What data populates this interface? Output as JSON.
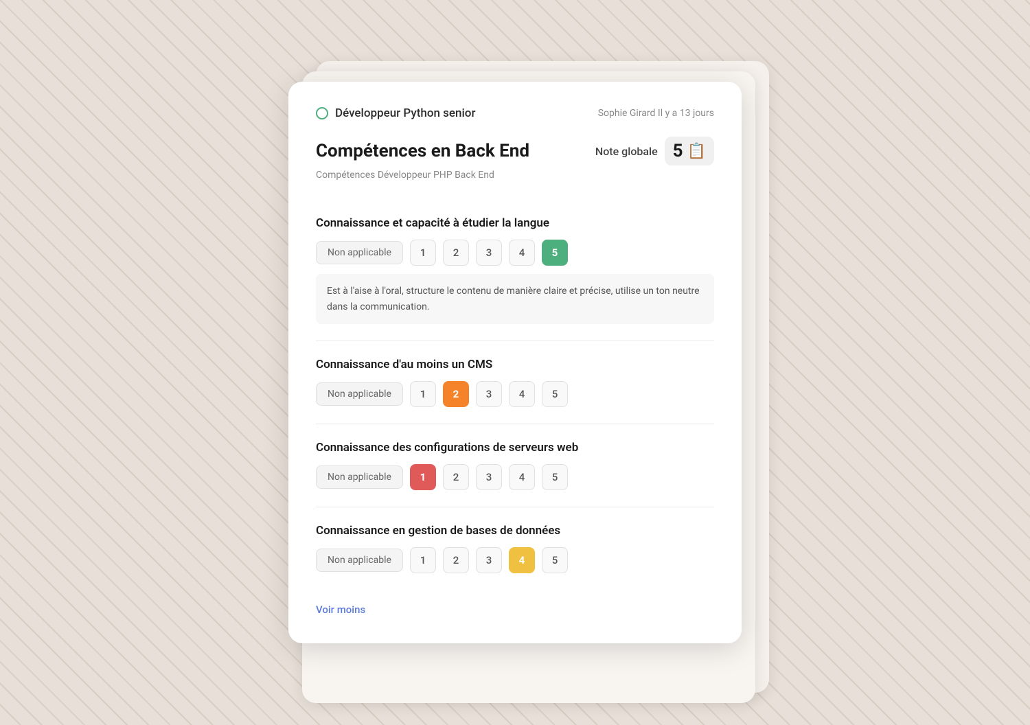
{
  "background": {
    "color": "#e8e0d8"
  },
  "card": {
    "job_title": "Développeur Python senior",
    "meta": "Sophie Girard Il y a 13 jours",
    "status_dot_color": "#4caf7d",
    "main_title": "Compétences en Back End",
    "subtitle": "Compétences Développeur PHP Back End",
    "note_globale_label": "Note globale",
    "note_value": "5",
    "note_icon": "📋"
  },
  "competencies": [
    {
      "id": "comp1",
      "name": "Connaissance et capacité à étudier la langue",
      "na_label": "Non applicable",
      "ratings": [
        "1",
        "2",
        "3",
        "4",
        "5"
      ],
      "active_rating": "5",
      "active_class": "active-green",
      "comment": "Est à l'aise à l'oral, structure le contenu de manière claire et précise, utilise un ton neutre dans la communication."
    },
    {
      "id": "comp2",
      "name": "Connaissance d'au moins un CMS",
      "na_label": "Non applicable",
      "ratings": [
        "1",
        "2",
        "3",
        "4",
        "5"
      ],
      "active_rating": "2",
      "active_class": "active-orange",
      "comment": ""
    },
    {
      "id": "comp3",
      "name": "Connaissance des configurations de serveurs web",
      "na_label": "Non applicable",
      "ratings": [
        "1",
        "2",
        "3",
        "4",
        "5"
      ],
      "active_rating": "1",
      "active_class": "active-red",
      "comment": ""
    },
    {
      "id": "comp4",
      "name": "Connaissance en gestion de bases de données",
      "na_label": "Non applicable",
      "ratings": [
        "1",
        "2",
        "3",
        "4",
        "5"
      ],
      "active_rating": "4",
      "active_class": "active-yellow",
      "comment": ""
    }
  ],
  "voir_moins_label": "Voir moins"
}
